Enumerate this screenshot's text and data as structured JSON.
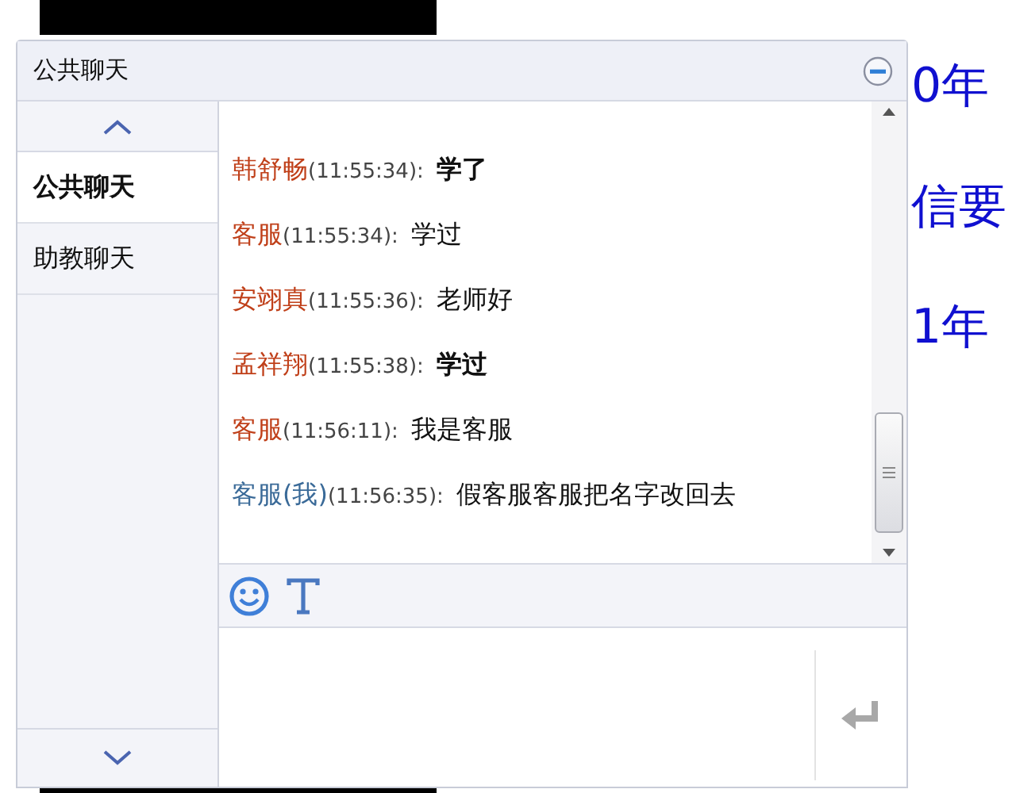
{
  "slide": {
    "texts": [
      "0年",
      "信要",
      "1年"
    ]
  },
  "panel": {
    "title": "公共聊天"
  },
  "tabs": [
    {
      "label": "公共聊天",
      "selected": true
    },
    {
      "label": "助教聊天",
      "selected": false
    }
  ],
  "messages": [
    {
      "name": "韩舒畅",
      "time": "(11:55:34):",
      "text": "学了",
      "self": false,
      "bold": true
    },
    {
      "name": "客服",
      "time": "(11:55:34):",
      "text": "学过",
      "self": false,
      "bold": false
    },
    {
      "name": "安翊真",
      "time": "(11:55:36):",
      "text": "老师好",
      "self": false,
      "bold": false
    },
    {
      "name": "孟祥翔",
      "time": "(11:55:38):",
      "text": "学过",
      "self": false,
      "bold": true
    },
    {
      "name": "客服",
      "time": "(11:56:11):",
      "text": "我是客服",
      "self": false,
      "bold": false
    },
    {
      "name": "客服(我)",
      "time": "(11:56:35):",
      "text": "假客服客服把名字改回去",
      "self": true,
      "bold": false
    }
  ]
}
